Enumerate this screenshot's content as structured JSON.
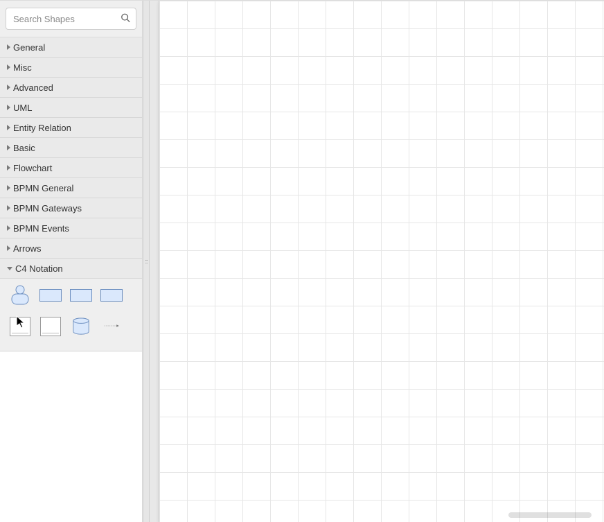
{
  "search": {
    "placeholder": "Search Shapes",
    "value": ""
  },
  "categories": [
    {
      "label": "General",
      "expanded": false
    },
    {
      "label": "Misc",
      "expanded": false
    },
    {
      "label": "Advanced",
      "expanded": false
    },
    {
      "label": "UML",
      "expanded": false
    },
    {
      "label": "Entity Relation",
      "expanded": false
    },
    {
      "label": "Basic",
      "expanded": false
    },
    {
      "label": "Flowchart",
      "expanded": false
    },
    {
      "label": "BPMN General",
      "expanded": false
    },
    {
      "label": "BPMN Gateways",
      "expanded": false
    },
    {
      "label": "BPMN Events",
      "expanded": false
    },
    {
      "label": "Arrows",
      "expanded": false
    },
    {
      "label": "C4 Notation",
      "expanded": true
    }
  ],
  "c4_shapes": [
    {
      "name": "person",
      "icon": "person"
    },
    {
      "name": "software-system",
      "icon": "rect-blue"
    },
    {
      "name": "container",
      "icon": "rect-blue"
    },
    {
      "name": "component",
      "icon": "rect-blue"
    },
    {
      "name": "system-boundary",
      "icon": "rect-white"
    },
    {
      "name": "container-boundary",
      "icon": "rect-white"
    },
    {
      "name": "database",
      "icon": "database"
    },
    {
      "name": "relationship",
      "icon": "arrow"
    }
  ],
  "colors": {
    "shape_fill": "#dae8fc",
    "shape_stroke": "#6c8ebf",
    "grid": "#e6e6e6"
  },
  "splitter_handle": "::"
}
